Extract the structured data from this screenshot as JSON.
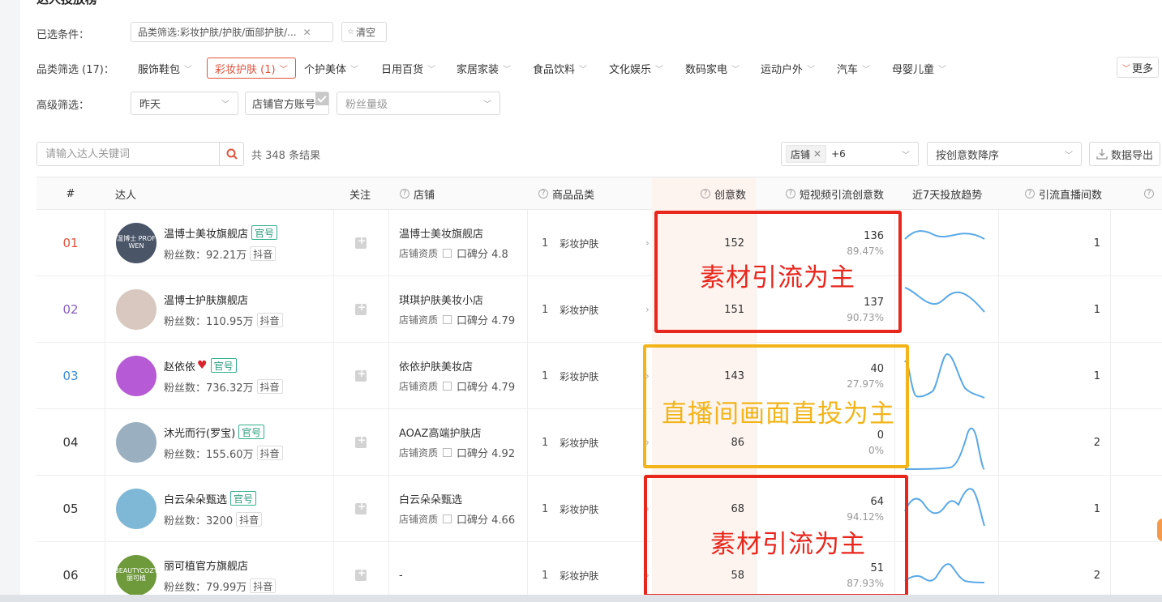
{
  "page": {
    "title": "达人投放榜"
  },
  "filters": {
    "selected_label": "已选条件：",
    "selected_chip": "品类筛选:彩妆护肤/护肤/面部护肤/...",
    "clear_label": "清空",
    "category_label": "品类筛选 (17)：",
    "categories": [
      {
        "label": "服饰鞋包"
      },
      {
        "label": "彩妆护肤 (1)"
      },
      {
        "label": "个护美体"
      },
      {
        "label": "日用百货"
      },
      {
        "label": "家居家装"
      },
      {
        "label": "食品饮料"
      },
      {
        "label": "文化娱乐"
      },
      {
        "label": "数码家电"
      },
      {
        "label": "运动户外"
      },
      {
        "label": "汽车"
      },
      {
        "label": "母婴儿童"
      }
    ],
    "more_label": "更多",
    "advanced_label": "高级筛选：",
    "date_value": "昨天",
    "shop_official": "店铺官方账号",
    "fans_placeholder": "粉丝量级"
  },
  "toolbar": {
    "search_placeholder": "请输入达人关键词",
    "result_count": "共 348 条结果",
    "tag_chip": "店铺",
    "tag_more": "+6",
    "sort_value": "按创意数降序",
    "export_label": "数据导出"
  },
  "table": {
    "headers": {
      "rank": "#",
      "influencer": "达人",
      "follow": "关注",
      "shop": "店铺",
      "category": "商品品类",
      "creatives": "创意数",
      "video_creatives": "短视频引流创意数",
      "trend": "近7天投放趋势",
      "live_rooms": "引流直播间数"
    },
    "rows": [
      {
        "rank": "01",
        "name": "温博士美妆旗舰店",
        "official": "官号",
        "fans": "粉丝数：92.21万",
        "platform": "抖音",
        "avatar_text": "温博士 PROF WEN",
        "shop": "温博士美妆旗舰店",
        "shop_qual": "店铺资质",
        "score": "口碑分 4.8",
        "cat_n": "1",
        "category": "彩妆护肤",
        "creatives": "152",
        "video": "136",
        "video_pct": "89.47%",
        "live": "1"
      },
      {
        "rank": "02",
        "name": "温博士护肤旗舰店",
        "official": "",
        "fans": "粉丝数：110.95万",
        "platform": "抖音",
        "avatar_text": "",
        "shop": "琪琪护肤美妆小店",
        "shop_qual": "店铺资质",
        "score": "口碑分 4.79",
        "cat_n": "1",
        "category": "彩妆护肤",
        "creatives": "151",
        "video": "137",
        "video_pct": "90.73%",
        "live": "1"
      },
      {
        "rank": "03",
        "name": "赵依依",
        "official": "官号",
        "fans": "粉丝数：736.32万",
        "platform": "抖音",
        "avatar_text": "",
        "shop": "依依护肤美妆店",
        "shop_qual": "店铺资质",
        "score": "口碑分 4.79",
        "cat_n": "1",
        "category": "彩妆护肤",
        "creatives": "143",
        "video": "40",
        "video_pct": "27.97%",
        "live": "1"
      },
      {
        "rank": "04",
        "name": "沐光而行(罗宝)",
        "official": "官号",
        "fans": "粉丝数：155.60万",
        "platform": "抖音",
        "avatar_text": "",
        "shop": "AOAZ高端护肤店",
        "shop_qual": "店铺资质",
        "score": "口碑分 4.92",
        "cat_n": "1",
        "category": "彩妆护肤",
        "creatives": "86",
        "video": "0",
        "video_pct": "0%",
        "live": "2"
      },
      {
        "rank": "05",
        "name": "白云朵朵甄选",
        "official": "官号",
        "fans": "粉丝数：3200",
        "platform": "抖音",
        "avatar_text": "",
        "shop": "白云朵朵甄选",
        "shop_qual": "店铺资质",
        "score": "口碑分 4.66",
        "cat_n": "1",
        "category": "彩妆护肤",
        "creatives": "68",
        "video": "64",
        "video_pct": "94.12%",
        "live": "1"
      },
      {
        "rank": "06",
        "name": "丽可植官方旗舰店",
        "official": "",
        "fans": "粉丝数：79.99万",
        "platform": "抖音",
        "avatar_text": "BEAUTYCOZY 丽可植",
        "shop": "-",
        "shop_qual": "",
        "score": "",
        "cat_n": "1",
        "category": "彩妆护肤",
        "creatives": "58",
        "video": "51",
        "video_pct": "87.93%",
        "live": "2"
      }
    ]
  },
  "annotations": {
    "box1_text": "素材引流为主",
    "box2_text": "直播间画面直投为主",
    "box3_text": "素材引流为主"
  },
  "colors": {
    "accent": "#e0533c",
    "annotation_red": "#e8261c",
    "annotation_yellow": "#f2b418",
    "trend_line": "#5aa9e6"
  }
}
